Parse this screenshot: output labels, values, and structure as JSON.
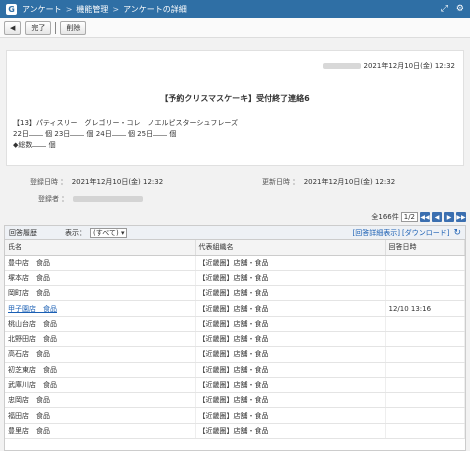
{
  "titlebar": {
    "crumbs": [
      "アンケート",
      "機能管理",
      "アンケートの詳細"
    ],
    "icon": "app-icon"
  },
  "toolbar": {
    "back_label": "◀",
    "complete_label": "完了",
    "delete_label": "削除"
  },
  "card": {
    "date": "2021年12月10日(金) 12:32",
    "title": "【予約クリスマスケーキ】受付終了連絡6",
    "line1": "【13】パティスリー　グレゴリー・コレ　ノエルピスターシュフレーズ",
    "line2_d1": "22日",
    "line2_u": "個",
    "line2_d2": "23日",
    "line2_d3": "24日",
    "line2_d4": "25日",
    "line3": "◆総数",
    "line3_u": "個"
  },
  "meta": {
    "reg_label": "登録日時 ：",
    "reg_value": "2021年12月10日(金) 12:32",
    "upd_label": "更新日時 ：",
    "upd_value": "2021年12月10日(金) 12:32",
    "by_label": "登録者 ："
  },
  "pager": {
    "total": "全166件",
    "page": "1/2"
  },
  "panel": {
    "title": "回答履歴",
    "show_label": "表示：",
    "show_value": "(すべて)",
    "link1": "[回答詳細表示]",
    "link2": "[ダウンロード]",
    "columns": [
      "氏名",
      "代表組織名",
      "回答日時"
    ],
    "rows": [
      {
        "name": "豊中店　食品",
        "org": "【近畿圏】店舗・食品",
        "date": ""
      },
      {
        "name": "塚本店　食品",
        "org": "【近畿圏】店舗・食品",
        "date": ""
      },
      {
        "name": "岡町店　食品",
        "org": "【近畿圏】店舗・食品",
        "date": ""
      },
      {
        "name": "甲子園店　食品",
        "org": "【近畿圏】店舗・食品",
        "date": "12/10 13:16"
      },
      {
        "name": "桃山台店　食品",
        "org": "【近畿圏】店舗・食品",
        "date": ""
      },
      {
        "name": "北野田店　食品",
        "org": "【近畿圏】店舗・食品",
        "date": ""
      },
      {
        "name": "高石店　食品",
        "org": "【近畿圏】店舗・食品",
        "date": ""
      },
      {
        "name": "初芝東店　食品",
        "org": "【近畿圏】店舗・食品",
        "date": ""
      },
      {
        "name": "武庫川店　食品",
        "org": "【近畿圏】店舗・食品",
        "date": ""
      },
      {
        "name": "忠岡店　食品",
        "org": "【近畿圏】店舗・食品",
        "date": ""
      },
      {
        "name": "福田店　食品",
        "org": "【近畿圏】店舗・食品",
        "date": ""
      },
      {
        "name": "豊里店　食品",
        "org": "【近畿圏】店舗・食品",
        "date": ""
      }
    ]
  }
}
